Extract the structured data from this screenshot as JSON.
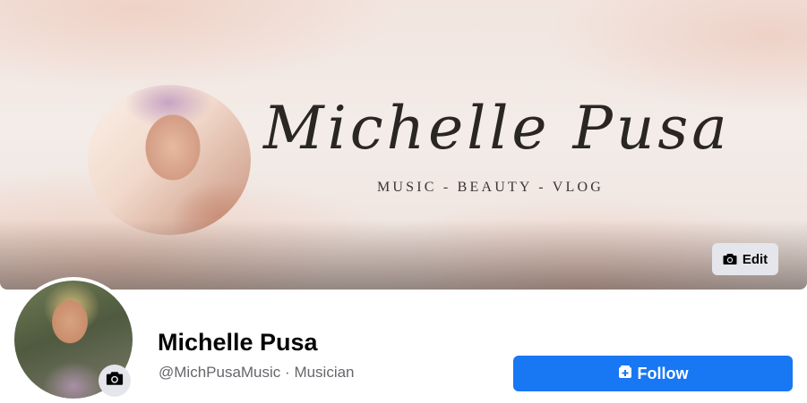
{
  "cover": {
    "brand_name": "Michelle Pusa",
    "tagline": "MUSIC - BEAUTY - VLOG",
    "edit_label": "Edit",
    "edit_icon": "camera-icon"
  },
  "profile": {
    "name": "Michelle Pusa",
    "handle": "@MichPusaMusic",
    "separator": "·",
    "category": "Musician",
    "avatar_action_icon": "camera-icon"
  },
  "actions": {
    "follow_label": "Follow",
    "follow_icon": "follow-icon"
  },
  "colors": {
    "accent": "#1877f2",
    "secondary_button": "#e4e6eb",
    "primary_text": "#050505",
    "secondary_text": "#65676b"
  }
}
